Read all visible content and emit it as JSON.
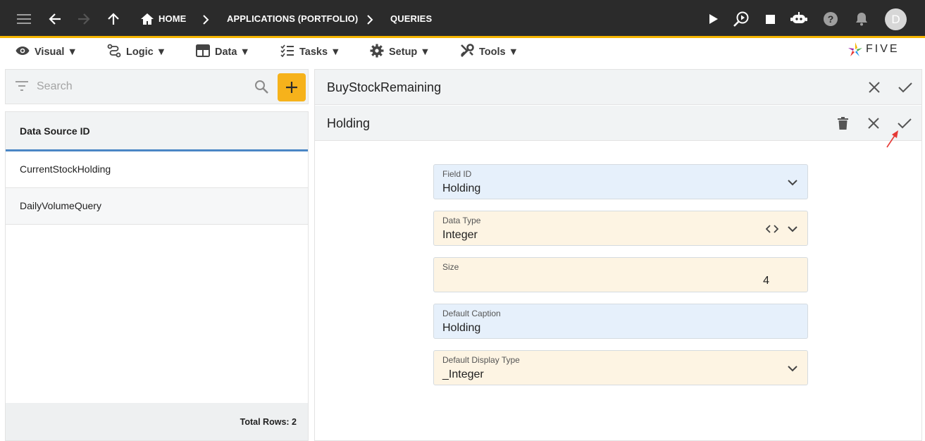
{
  "breadcrumb": {
    "home": "HOME",
    "applications": "APPLICATIONS (PORTFOLIO)",
    "queries": "QUERIES"
  },
  "user": {
    "avatar_initial": "D"
  },
  "menu": {
    "items": [
      {
        "label": "Visual ▼",
        "icon": "eye-icon"
      },
      {
        "label": "Logic ▼",
        "icon": "logic-icon"
      },
      {
        "label": "Data ▼",
        "icon": "table-icon"
      },
      {
        "label": "Tasks ▼",
        "icon": "tasks-icon"
      },
      {
        "label": "Setup ▼",
        "icon": "gear-icon"
      },
      {
        "label": "Tools ▼",
        "icon": "tools-icon"
      }
    ],
    "logo_text": "FIVE"
  },
  "search": {
    "placeholder": "Search"
  },
  "list": {
    "header": "Data Source ID",
    "rows": [
      "CurrentStockHolding",
      "DailyVolumeQuery"
    ],
    "footer": "Total Rows: 2"
  },
  "form": {
    "parent_title": "BuyStockRemaining",
    "title": "Holding",
    "fields": [
      {
        "label": "Field ID",
        "value": "Holding"
      },
      {
        "label": "Data Type",
        "value": "Integer"
      },
      {
        "label": "Size",
        "value": "4"
      },
      {
        "label": "Default Caption",
        "value": "Holding"
      },
      {
        "label": "Default Display Type",
        "value": "_Integer"
      }
    ]
  },
  "colors": {
    "appbar": "#2b2b2b",
    "accent": "#f4b400",
    "add_button": "#f6b21b",
    "field_blue": "#e6f0fb",
    "field_cream": "#fdf4e3",
    "selection_underline": "#4a86c5",
    "annotation_arrow": "#e53935"
  }
}
